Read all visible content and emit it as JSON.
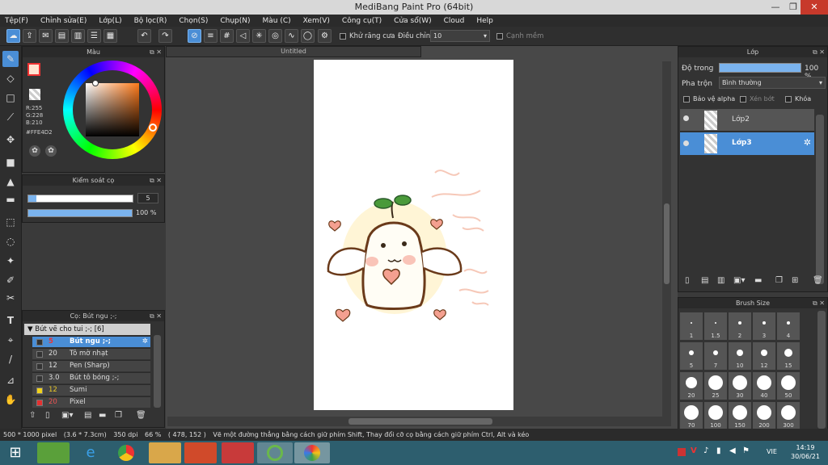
{
  "app_title": "MediBang Paint Pro (64bit)",
  "menu": [
    "Tệp(F)",
    "Chỉnh sửa(E)",
    "Lớp(L)",
    "Bộ lọc(R)",
    "Chọn(S)",
    "Chụp(N)",
    "Màu (C)",
    "Xem(V)",
    "Công cụ(T)",
    "Cửa sổ(W)",
    "Cloud",
    "Help"
  ],
  "toolbar": {
    "antialias_label": "Khử răng cưa",
    "correction_label": "Điều chỉnh",
    "correction_value": "10",
    "edge_label": "Cạnh mềm"
  },
  "color_panel": {
    "title": "Màu",
    "r": "R:255",
    "g": "G:228",
    "b": "B:210",
    "hex": "#FFE4D2",
    "fg_color": "#ffe4d2"
  },
  "brush_control": {
    "title": "Kiểm soát cọ",
    "size_value": "5",
    "opacity_value": "100 %"
  },
  "brush_panel": {
    "title": "Cọ: Bút ngu ;-;",
    "group": "Bút vẽ cho tui ;-; [6]",
    "items": [
      {
        "size": "5",
        "name": "Bút ngu ;-;",
        "color": "#333333",
        "selected": true
      },
      {
        "size": "20",
        "name": "Tô mờ nhạt",
        "color": "#333333",
        "selected": false
      },
      {
        "size": "12",
        "name": "Pen (Sharp)",
        "color": "#333333",
        "selected": false
      },
      {
        "size": "3.0",
        "name": "Bút tô bóng ;-;",
        "color": "#333333",
        "selected": false
      },
      {
        "size": "12",
        "name": "Sumi",
        "color": "#f2d21a",
        "selected": false
      },
      {
        "size": "20",
        "name": "Pixel",
        "color": "#e53030",
        "selected": false
      }
    ]
  },
  "document": {
    "tab": "Untitled"
  },
  "layer_panel": {
    "title": "Lớp",
    "opacity_label": "Độ trong",
    "opacity_value": "100 %",
    "blend_label": "Pha trộn",
    "blend_value": "Bình thường",
    "protect_alpha": "Bảo vệ alpha",
    "clipping": "Xén bớt",
    "lock": "Khóa",
    "layers": [
      {
        "name": "Lớp2",
        "selected": false
      },
      {
        "name": "Lớp3",
        "selected": true
      }
    ]
  },
  "size_panel": {
    "title": "Brush Size",
    "sizes": [
      "1",
      "1.5",
      "2",
      "3",
      "4",
      "5",
      "7",
      "10",
      "12",
      "15",
      "20",
      "25",
      "30",
      "40",
      "50",
      "70",
      "100",
      "150",
      "200",
      "300"
    ]
  },
  "status": {
    "dimensions": "500 * 1000 pixel",
    "physical": "(3.6 * 7.3cm)",
    "dpi": "350 dpi",
    "zoom": "66 %",
    "coords": "( 478, 152 )",
    "hint": "Vẽ một đường thẳng bằng cách giữ phím Shift, Thay đổi cỡ cọ bằng cách giữ phím Ctrl, Alt và kéo"
  },
  "taskbar": {
    "lang": "VIE",
    "time": "14:19",
    "date": "30/06/21"
  }
}
